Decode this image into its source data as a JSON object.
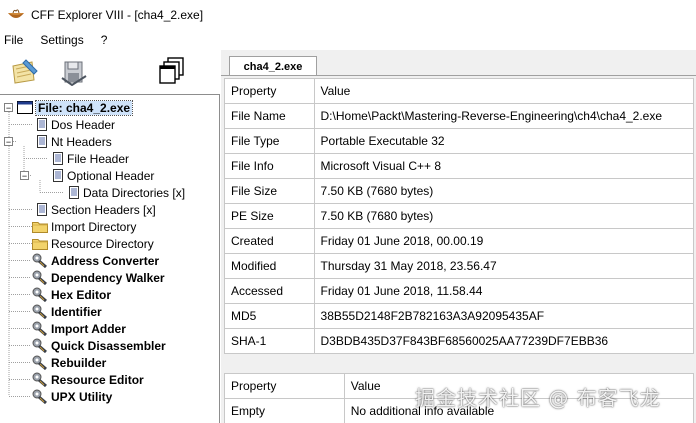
{
  "window": {
    "title": "CFF Explorer VIII - [cha4_2.exe]"
  },
  "menu": [
    "File",
    "Settings",
    "?"
  ],
  "toolbar": {
    "buttons": [
      "open-file-icon",
      "save-file-icon",
      "windows-icon"
    ]
  },
  "tree": [
    {
      "label": "File: cha4_2.exe",
      "icon": "window-icon",
      "bold": true,
      "selected": true,
      "expander": "minus"
    },
    {
      "label": "Dos Header",
      "icon": "document-icon"
    },
    {
      "label": "Nt Headers",
      "icon": "document-icon",
      "expander": "minus"
    },
    {
      "label": "File Header",
      "icon": "document-icon"
    },
    {
      "label": "Optional Header",
      "icon": "document-icon",
      "expander": "minus"
    },
    {
      "label": "Data Directories [x]",
      "icon": "document-icon"
    },
    {
      "label": "Section Headers [x]",
      "icon": "document-icon"
    },
    {
      "label": "Import Directory",
      "icon": "folder-icon"
    },
    {
      "label": "Resource Directory",
      "icon": "folder-icon"
    },
    {
      "label": "Address Converter",
      "icon": "tool-icon",
      "bold": true
    },
    {
      "label": "Dependency Walker",
      "icon": "tool-icon",
      "bold": true
    },
    {
      "label": "Hex Editor",
      "icon": "tool-icon",
      "bold": true
    },
    {
      "label": "Identifier",
      "icon": "tool-icon",
      "bold": true
    },
    {
      "label": "Import Adder",
      "icon": "tool-icon",
      "bold": true
    },
    {
      "label": "Quick Disassembler",
      "icon": "tool-icon",
      "bold": true
    },
    {
      "label": "Rebuilder",
      "icon": "tool-icon",
      "bold": true
    },
    {
      "label": "Resource Editor",
      "icon": "tool-icon",
      "bold": true
    },
    {
      "label": "UPX Utility",
      "icon": "tool-icon",
      "bold": true
    }
  ],
  "tab": {
    "label": "cha4_2.exe"
  },
  "properties": {
    "headers": [
      "Property",
      "Value"
    ],
    "rows": [
      [
        "File Name",
        "D:\\Home\\Packt\\Mastering-Reverse-Engineering\\ch4\\cha4_2.exe"
      ],
      [
        "File Type",
        "Portable Executable 32"
      ],
      [
        "File Info",
        "Microsoft Visual C++ 8"
      ],
      [
        "File Size",
        "7.50 KB (7680 bytes)"
      ],
      [
        "PE Size",
        "7.50 KB (7680 bytes)"
      ],
      [
        "Created",
        "Friday 01 June 2018, 00.00.19"
      ],
      [
        "Modified",
        "Thursday 31 May 2018, 23.56.47"
      ],
      [
        "Accessed",
        "Friday 01 June 2018, 11.58.44"
      ],
      [
        "MD5",
        "38B55D2148F2B782163A3A92095435AF"
      ],
      [
        "SHA-1",
        "D3BDB435D37F843BF68560025AA77239DF7EBB36"
      ]
    ]
  },
  "info_table": {
    "headers": [
      "Property",
      "Value"
    ],
    "rows": [
      [
        "Empty",
        "No additional info available"
      ]
    ]
  },
  "watermark": "掘金技术社区 @ 布客飞龙"
}
